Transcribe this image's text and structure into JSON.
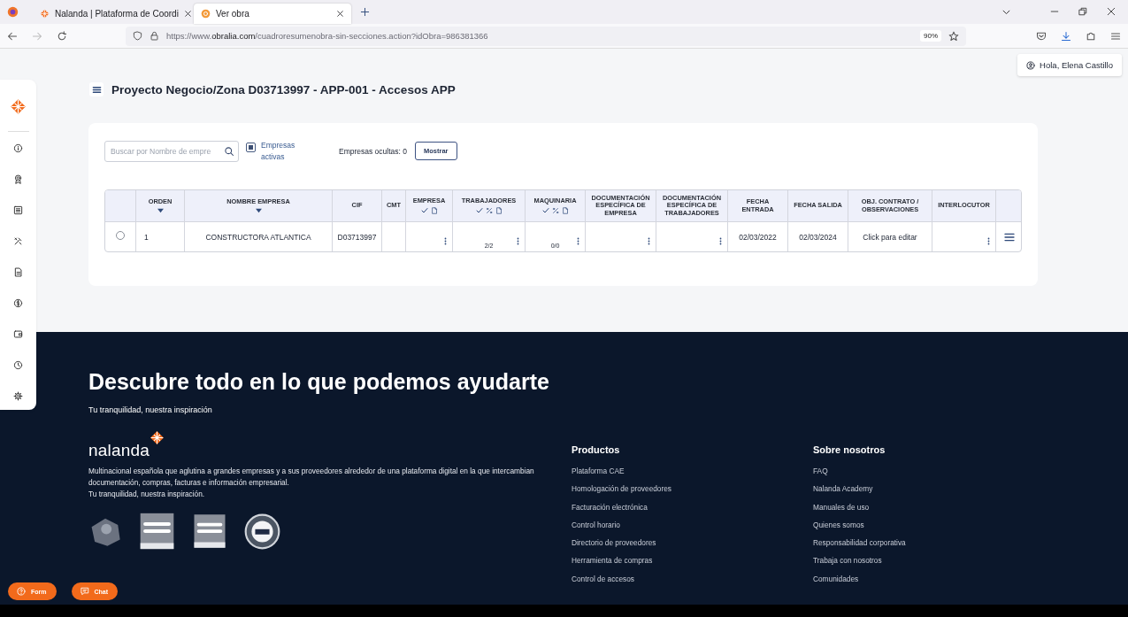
{
  "browser": {
    "tabs": [
      {
        "title": "Nalanda | Plataforma de Coordi",
        "selected": false
      },
      {
        "title": "Ver obra",
        "selected": true
      }
    ],
    "url": "https://www.**obralia.com**/cuadroresumenobra-sin-secciones.action?idObra=986381366",
    "zoom": "90%"
  },
  "user_button": "Hola, Elena Castillo",
  "page_title": "Proyecto Negocio/Zona D03713997 - APP-001 - Accesos APP",
  "filters": {
    "search_placeholder": "Buscar por Nombre de empre",
    "active_companies": {
      "label": "Empresas activas",
      "checked": true
    },
    "hidden_label": "Empresas ocultas: 0",
    "show_button": "Mostrar"
  },
  "table": {
    "columns": [
      {
        "label": "ORDEN",
        "kind": "sortable"
      },
      {
        "label": "NOMBRE EMPRESA",
        "kind": "sortable"
      },
      {
        "label": "CIF",
        "kind": "plain"
      },
      {
        "label": "CMT",
        "kind": "plain"
      },
      {
        "label": "EMPRESA",
        "kind": "status"
      },
      {
        "label": "TRABAJADORES",
        "kind": "status_percent"
      },
      {
        "label": "MAQUINARIA",
        "kind": "status_percent"
      },
      {
        "label": "DOCUMENTACIÓN ESPECÍFICA DE EMPRESA",
        "kind": "plain"
      },
      {
        "label": "DOCUMENTACIÓN ESPECÍFICA DE TRABAJADORES",
        "kind": "plain"
      },
      {
        "label": "FECHA ENTRADA",
        "kind": "plain"
      },
      {
        "label": "FECHA SALIDA",
        "kind": "plain"
      },
      {
        "label": "OBJ. CONTRATO / OBSERVACIONES",
        "kind": "plain"
      },
      {
        "label": "INTERLOCUTOR",
        "kind": "plain"
      }
    ],
    "rows": [
      {
        "selected": false,
        "cells": [
          {
            "kind": "text",
            "text": "1"
          },
          {
            "kind": "text",
            "text": "CONSTRUCTORA ATLANTICA"
          },
          {
            "kind": "text",
            "text": "D03713997"
          },
          {
            "kind": "empty"
          },
          {
            "kind": "menu"
          },
          {
            "kind": "count",
            "text": "2/2"
          },
          {
            "kind": "count",
            "text": "0/0"
          },
          {
            "kind": "menu"
          },
          {
            "kind": "menu"
          },
          {
            "kind": "text",
            "text": "02/03/2022"
          },
          {
            "kind": "text",
            "text": "02/03/2024"
          },
          {
            "kind": "text",
            "text": "Click para editar"
          },
          {
            "kind": "menu"
          }
        ]
      }
    ]
  },
  "footer": {
    "title": "Descubre todo en lo que podemos ayudarte",
    "subtitle": "Tu tranquilidad, nuestra inspiración",
    "logo": "nalanda",
    "description": "Multinacional española que aglutina a grandes empresas y a sus proveedores alrededor de una plataforma digital en la que intercambian documentación, compras, facturas e información empresarial.",
    "tagline": "Tu tranquilidad, nuestra inspiración.",
    "columns": [
      {
        "heading": "Productos",
        "links": [
          "Plataforma CAE",
          "Homologación de proveedores",
          "Facturación electrónica",
          "Control horario",
          "Directorio de proveedores",
          "Herramienta de compras",
          "Control de accesos"
        ]
      },
      {
        "heading": "Sobre nosotros",
        "links": [
          "FAQ",
          "Nalanda Academy",
          "Manuales de uso",
          "Quienes somos",
          "Responsabilidad corporativa",
          "Trabaja con nosotros",
          "Comunidades"
        ]
      }
    ]
  },
  "floating_buttons": [
    "Form",
    "Chat"
  ]
}
